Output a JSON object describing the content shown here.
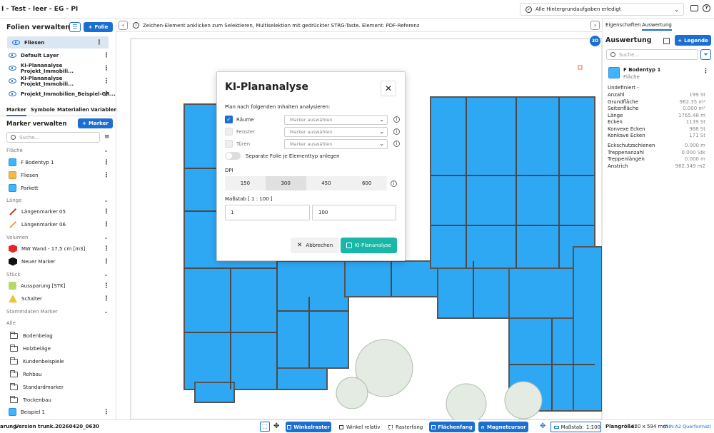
{
  "window": {
    "title": "I - Test - leer - EG - PI",
    "notification": "Alle Hintergrundaufgaben erledigt"
  },
  "infobar": {
    "text": "Zeichen-Element anklicken zum Selektieren, Multiselektion mit gedrückter STRG-Taste. Element: PDF-Referenz"
  },
  "sidebar": {
    "folien_title": "Folien verwalten",
    "folie_button": "Folie",
    "layers": [
      "Fliesen",
      "Default Layer",
      "KI-Plananalyse Projekt_Immobili...",
      "KI-Plananalyse Projekt_Immobili...",
      "Projekt_Immobilien_Beispiel-GR..."
    ],
    "tabs": [
      "Marker",
      "Symbole",
      "Materialien",
      "Variablen"
    ],
    "marker_title": "Marker verwalten",
    "marker_button": "Marker",
    "search_placeholder": "Suche...",
    "sections": [
      {
        "label": "Fläche",
        "items": [
          {
            "label": "F Bodentyp 1",
            "color": "#41b3ff"
          },
          {
            "label": "Fliesen",
            "color": "#f6b84b"
          },
          {
            "label": "Parkett",
            "color": "#41b3ff"
          }
        ]
      },
      {
        "label": "Länge",
        "items": [
          {
            "label": "Längenmarker 05",
            "color": "#c0392b"
          },
          {
            "label": "Längenmarker 06",
            "color": "#e8a23a"
          }
        ]
      },
      {
        "label": "Volumen",
        "items": [
          {
            "label": "MW Wand - 17,5 cm [m3]",
            "color": "#e02a2a"
          },
          {
            "label": "Neuer Marker",
            "color": "#111111"
          }
        ]
      },
      {
        "label": "Stück",
        "items": [
          {
            "label": "Aussparung [STK]",
            "color": "#b5d96a"
          },
          {
            "label": "Schalter",
            "color": "#f2c230"
          }
        ]
      }
    ],
    "stamm_label": "Stammdaten Marker",
    "alle_label": "Alle",
    "folders": [
      "Bodenbelag",
      "Holzbeläge",
      "Kundenbeispiele",
      "Rohbau",
      "Standardmarker",
      "Trockenbau",
      "Beispiel 1"
    ]
  },
  "rightpanel": {
    "tabs": [
      "Eigenschaften",
      "Auswertung"
    ],
    "title": "Auswertung",
    "legend_button": "Legende",
    "search_placeholder": "Suche...",
    "card": {
      "name": "F Bodentyp 1",
      "type": "Fläche"
    },
    "undef_label": "Undefiniert -",
    "stats": [
      [
        "Anzahl",
        "199 St"
      ],
      [
        "Grundfläche",
        "962.35 m²"
      ],
      [
        "Seitenfläche",
        "0.000 m²"
      ],
      [
        "Länge",
        "1765.48 m"
      ],
      [
        "Ecken",
        "1139 St"
      ],
      [
        "Konvexe Ecken",
        "968 St"
      ],
      [
        "Konkave Ecken",
        "171 St"
      ]
    ],
    "stats2": [
      [
        "Eckschutzschienen",
        "0.000 m"
      ],
      [
        "Treppenanzahl",
        "0.000 Stk"
      ],
      [
        "Treppenlängen",
        "0.000 m"
      ],
      [
        "Anstrich",
        "962.349 m2"
      ]
    ],
    "badge": "3D"
  },
  "dialog": {
    "title": "KI-Plananalyse",
    "subtitle": "Plan nach folgenden Inhalten analysieren:",
    "rows": [
      {
        "label": "Räume",
        "placeholder": "Marker auswählen",
        "checked": true
      },
      {
        "label": "Fenster",
        "placeholder": "Marker auswählen",
        "checked": false
      },
      {
        "label": "Türen",
        "placeholder": "Marker auswählen",
        "checked": false
      }
    ],
    "toggle_label": "Separate Folie je Elementtyp anlegen",
    "dpi_label": "DPI",
    "dpi_options": [
      "150",
      "300",
      "450",
      "600"
    ],
    "dpi_selected": "300",
    "scale_label": "Maßstab [ 1 : 100 ]",
    "scale_a": "1",
    "scale_b": "100",
    "cancel": "Abbrechen",
    "submit": "KI-Plananalyse"
  },
  "statusbar": {
    "left_a": "arung",
    "version": "Version trunk.20260420_0630",
    "buttons": [
      "Winkelraster",
      "Winkel relativ",
      "Rasterfang",
      "Flächenfang",
      "Magnetcursor"
    ],
    "scale_label": "Maßstab:",
    "scale_value": "1:100",
    "plan_label": "Plangröße:",
    "plan_value": "420 x 594 mm",
    "plan_format": "(DIN A2 Querformat)"
  }
}
